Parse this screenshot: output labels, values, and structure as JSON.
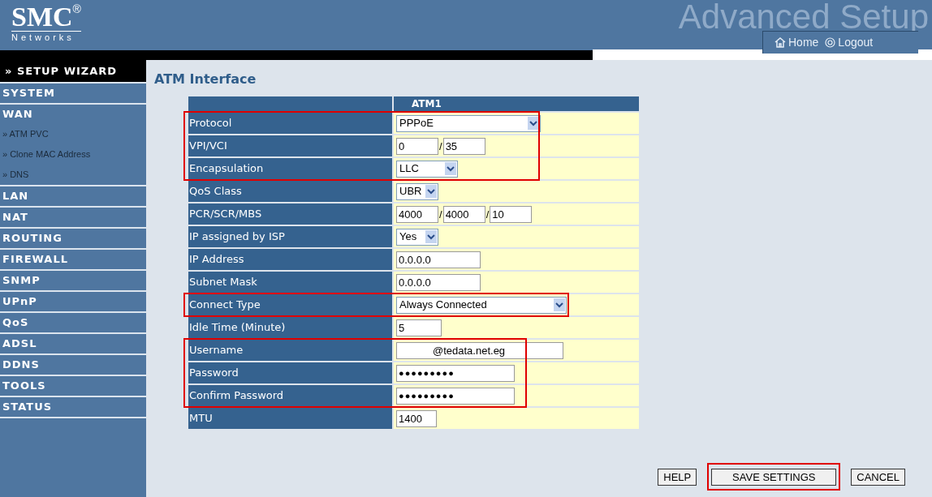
{
  "header": {
    "logo": "SMC",
    "logo_mark": "®",
    "logo_sub": "Networks",
    "banner": "Advanced Setup",
    "links": [
      {
        "kind": "home",
        "label": "Home"
      },
      {
        "kind": "logout",
        "label": "Logout"
      }
    ]
  },
  "sidebar": {
    "wizard": "» SETUP WIZARD",
    "items": [
      {
        "kind": "section",
        "label": "SYSTEM"
      },
      {
        "kind": "section",
        "label": "WAN"
      },
      {
        "kind": "sub",
        "label": "» ATM PVC"
      },
      {
        "kind": "sub",
        "label": "» Clone MAC Address"
      },
      {
        "kind": "sub",
        "label": "» DNS"
      },
      {
        "kind": "section",
        "label": "LAN"
      },
      {
        "kind": "section",
        "label": "NAT"
      },
      {
        "kind": "section",
        "label": "ROUTING"
      },
      {
        "kind": "section",
        "label": "FIREWALL"
      },
      {
        "kind": "section",
        "label": "SNMP"
      },
      {
        "kind": "section",
        "label": "UPnP"
      },
      {
        "kind": "section",
        "label": "QoS"
      },
      {
        "kind": "section",
        "label": "ADSL"
      },
      {
        "kind": "section",
        "label": "DDNS"
      },
      {
        "kind": "section",
        "label": "TOOLS"
      },
      {
        "kind": "section",
        "label": "STATUS"
      }
    ]
  },
  "page_title": "ATM Interface",
  "table": {
    "column_header": "ATM1",
    "rows": [
      {
        "label": "Protocol",
        "kind": "select",
        "values": [
          "PPPoE"
        ],
        "highlighted": true
      },
      {
        "label": "VPI/VCI",
        "kind": "multi",
        "values": [
          "0",
          "35"
        ],
        "separator": "/",
        "highlighted": true
      },
      {
        "label": "Encapsulation",
        "kind": "select",
        "values": [
          "LLC"
        ],
        "highlighted": true
      },
      {
        "label": "QoS Class",
        "kind": "select",
        "values": [
          "UBR"
        ],
        "highlighted": false
      },
      {
        "label": "PCR/SCR/MBS",
        "kind": "multi",
        "values": [
          "4000",
          "4000",
          "10"
        ],
        "separator": "/",
        "highlighted": false
      },
      {
        "label": "IP assigned by ISP",
        "kind": "select",
        "values": [
          "Yes"
        ],
        "highlighted": false
      },
      {
        "label": "IP Address",
        "kind": "input",
        "values": [
          "0.0.0.0"
        ],
        "highlighted": false
      },
      {
        "label": "Subnet Mask",
        "kind": "input",
        "values": [
          "0.0.0.0"
        ],
        "highlighted": false
      },
      {
        "label": "Connect Type",
        "kind": "select",
        "values": [
          "Always Connected"
        ],
        "highlighted": true
      },
      {
        "label": "Idle Time (Minute)",
        "kind": "input",
        "values": [
          "5"
        ],
        "highlighted": false
      },
      {
        "label": "Username",
        "kind": "input",
        "values": [
          "@tedata.net.eg"
        ],
        "highlighted": true
      },
      {
        "label": "Password",
        "kind": "password",
        "values": [
          "●●●●●●●●●"
        ],
        "highlighted": true
      },
      {
        "label": "Confirm Password",
        "kind": "password",
        "values": [
          "●●●●●●●●●"
        ],
        "highlighted": true
      },
      {
        "label": "MTU",
        "kind": "input",
        "values": [
          "1400"
        ],
        "highlighted": false
      }
    ]
  },
  "buttons": [
    {
      "label": "HELP",
      "highlighted": false
    },
    {
      "label": "SAVE SETTINGS",
      "highlighted": true
    },
    {
      "label": "CANCEL",
      "highlighted": false
    }
  ]
}
